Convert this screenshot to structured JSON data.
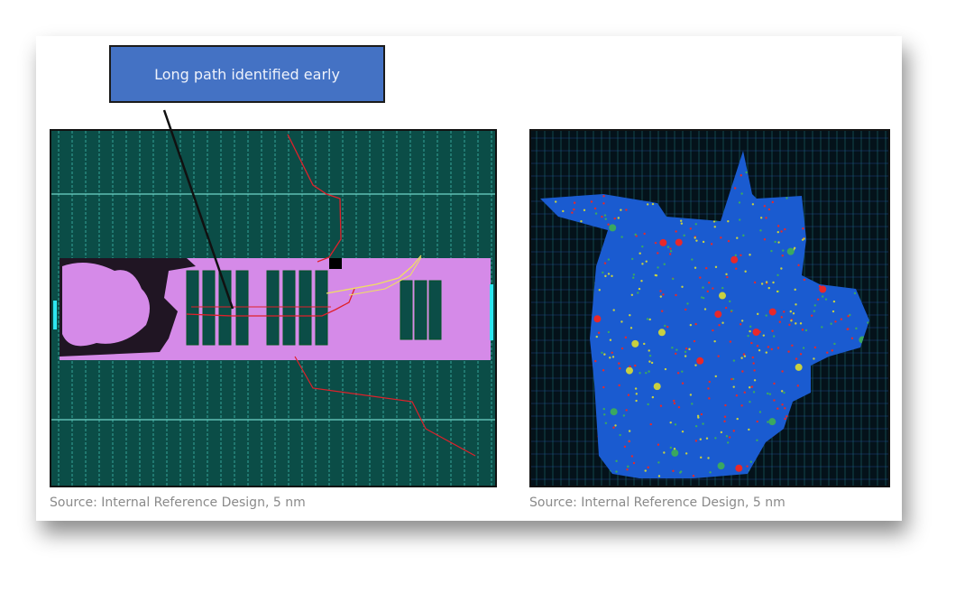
{
  "callout": {
    "text": "Long path identified early"
  },
  "left_figure": {
    "caption": "Source: Internal Reference Design, 5 nm"
  },
  "right_figure": {
    "caption": "Source: Internal Reference Design, 5 nm"
  },
  "colors": {
    "callout_fill": "#4472c4",
    "layout_teal": "#0b4d47",
    "macro_pink": "#d58ae8",
    "path_red": "#e0202a",
    "path_yellow": "#f0e060",
    "heatmap_blue": "#1a5bd0"
  }
}
